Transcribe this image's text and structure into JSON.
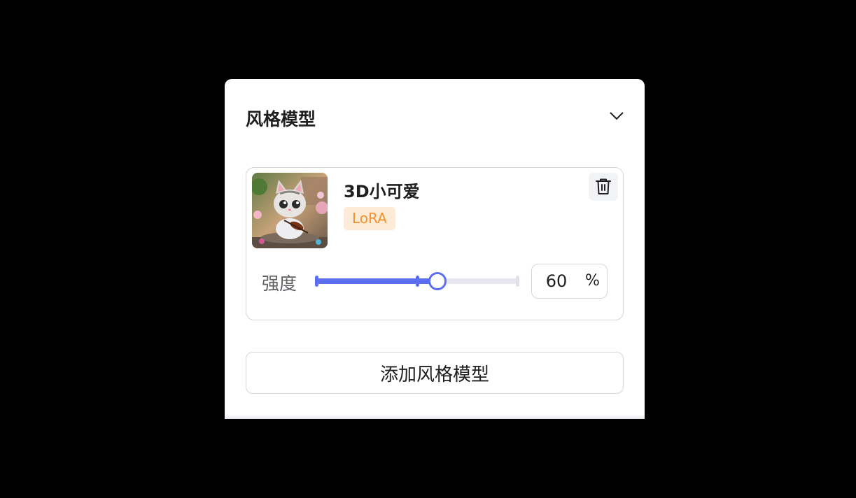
{
  "panel": {
    "title": "风格模型",
    "collapse_icon": "chevron-down-icon"
  },
  "model": {
    "name": "3D小可爱",
    "tag": "LoRA",
    "thumbnail": "cat-illustration-thumbnail",
    "delete_icon": "trash-icon"
  },
  "strength": {
    "label": "强度",
    "value": "60",
    "unit": "%",
    "fraction": 0.6,
    "default_fraction": 0.5
  },
  "actions": {
    "add_label": "添加风格模型"
  },
  "colors": {
    "accent": "#5b6ff0",
    "tag_bg": "#fdebd8",
    "tag_text": "#f3912e"
  }
}
